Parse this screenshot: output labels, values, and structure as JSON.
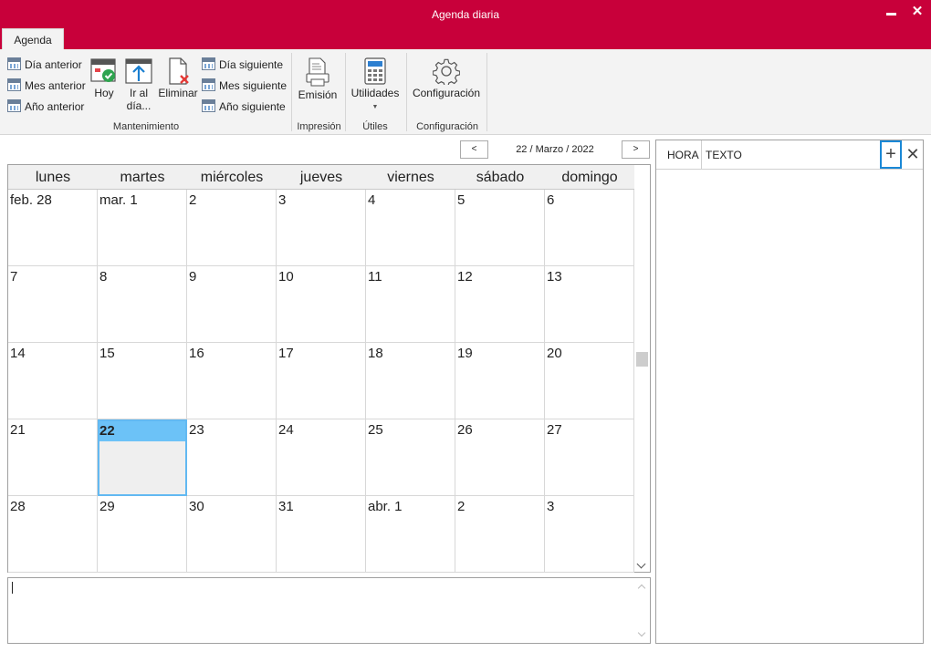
{
  "window": {
    "title": "Agenda diaria"
  },
  "tabs": [
    {
      "label": "Agenda"
    }
  ],
  "ribbon": {
    "mantenimiento": {
      "label": "Mantenimiento",
      "dia_anterior": "Día anterior",
      "mes_anterior": "Mes anterior",
      "ano_anterior": "Año anterior",
      "hoy": "Hoy",
      "ir_al_dia_1": "Ir al",
      "ir_al_dia_2": "día...",
      "eliminar": "Eliminar",
      "dia_siguiente": "Día siguiente",
      "mes_siguiente": "Mes siguiente",
      "ano_siguiente": "Año siguiente"
    },
    "impresion": {
      "label": "Impresión",
      "emision": "Emisión"
    },
    "utiles": {
      "label": "Útiles",
      "utilidades": "Utilidades"
    },
    "configuracion": {
      "label": "Configuración",
      "configuracion": "Configuración"
    }
  },
  "nav": {
    "prev": "<",
    "next": ">",
    "date": "22 / Marzo / 2022"
  },
  "calendar": {
    "days": [
      "lunes",
      "martes",
      "miércoles",
      "jueves",
      "viernes",
      "sábado",
      "domingo"
    ],
    "weeks": [
      [
        "feb. 28",
        "mar. 1",
        "2",
        "3",
        "4",
        "5",
        "6"
      ],
      [
        "7",
        "8",
        "9",
        "10",
        "11",
        "12",
        "13"
      ],
      [
        "14",
        "15",
        "16",
        "17",
        "18",
        "19",
        "20"
      ],
      [
        "21",
        "22",
        "23",
        "24",
        "25",
        "26",
        "27"
      ],
      [
        "28",
        "29",
        "30",
        "31",
        "abr. 1",
        "2",
        "3"
      ]
    ],
    "selected": "22"
  },
  "panel": {
    "hora": "HORA",
    "texto": "TEXTO",
    "add": "+",
    "delete": "✕"
  },
  "colors": {
    "titlebar": "#c8003a",
    "selected": "#6cc2f7"
  }
}
